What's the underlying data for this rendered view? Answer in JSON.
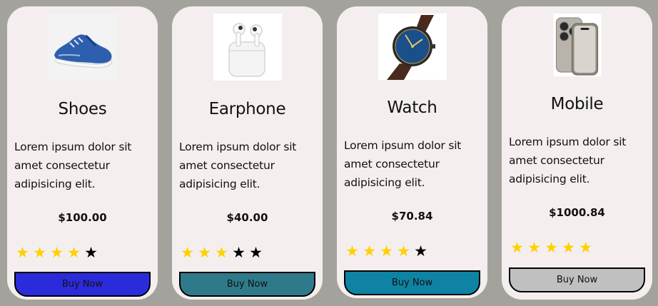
{
  "products": [
    {
      "title": "Shoes",
      "image_icon": "sneaker-icon",
      "description": "Lorem ipsum dolor sit amet consectetur adipisicing elit.",
      "price": "$100.00",
      "rating": 4,
      "rating_max": 5,
      "button_label": "Buy Now",
      "button_color": "#2b2bdc"
    },
    {
      "title": "Earphone",
      "image_icon": "earbuds-icon",
      "description": "Lorem ipsum dolor sit amet consectetur adipisicing elit.",
      "price": "$40.00",
      "rating": 3,
      "rating_max": 5,
      "button_label": "Buy Now",
      "button_color": "#2f7a8a"
    },
    {
      "title": "Watch",
      "image_icon": "wristwatch-icon",
      "description": "Lorem ipsum dolor sit amet consectetur adipisicing elit.",
      "price": "$70.84",
      "rating": 4,
      "rating_max": 5,
      "button_label": "Buy Now",
      "button_color": "#0e83a3"
    },
    {
      "title": "Mobile",
      "image_icon": "smartphone-icon",
      "description": "Lorem ipsum dolor sit amet consectetur adipisicing elit.",
      "price": "$1000.84",
      "rating": 5,
      "rating_max": 5,
      "button_label": "Buy Now",
      "button_color": "#c0c0c0"
    }
  ]
}
